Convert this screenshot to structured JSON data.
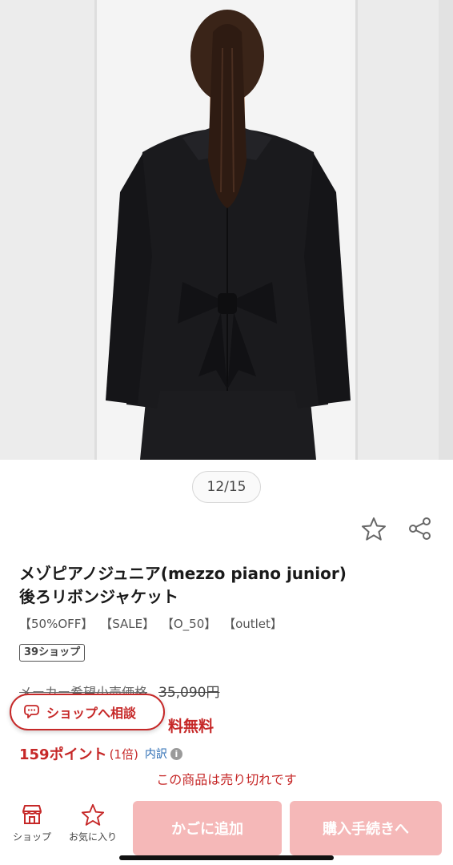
{
  "gallery": {
    "counter": "12/15"
  },
  "product": {
    "title_line1": "メゾピアノジュニア(mezzo piano junior)",
    "title_line2": "後ろリボンジャケット",
    "tags": [
      "【50%OFF】",
      "【SALE】",
      "【O_50】",
      "【outlet】"
    ],
    "shop_badge": "39ショップ",
    "msrp_label": "メーカー希望小売価格",
    "msrp_value": "35,090円",
    "shipping_partial": "料無料",
    "points": "159ポイント",
    "points_ratio": "(1倍)",
    "points_breakdown": "内訳",
    "sold_out": "この商品は売り切れです"
  },
  "consult_button": {
    "label": "ショップへ相談"
  },
  "bottom_bar": {
    "shop_label": "ショップ",
    "favorite_label": "お気に入り",
    "add_to_cart": "かごに追加",
    "checkout": "購入手続きへ"
  },
  "colors": {
    "accent_red": "#c62828",
    "disabled_button": "#f5b8b8",
    "link_blue": "#2a6bb3"
  },
  "icons": [
    "star-outline-icon",
    "share-icon",
    "chat-bubble-icon",
    "shop-icon",
    "info-icon"
  ]
}
